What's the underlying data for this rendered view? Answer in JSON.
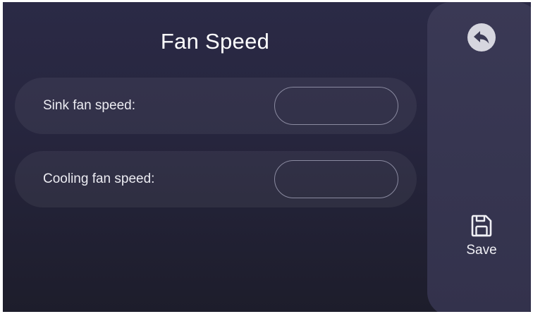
{
  "page": {
    "title": "Fan Speed"
  },
  "settings": {
    "sink_fan": {
      "label": "Sink fan speed:",
      "value": ""
    },
    "cooling_fan": {
      "label": "Cooling fan speed:",
      "value": ""
    }
  },
  "sidebar": {
    "back_icon": "back-arrow-icon",
    "save_icon": "floppy-disk-icon",
    "save_label": "Save"
  },
  "colors": {
    "background": "#26253d",
    "panel": "#3a3955",
    "row_fill": "#302f46",
    "input_border": "#8a8aa0",
    "text": "#ffffff"
  }
}
